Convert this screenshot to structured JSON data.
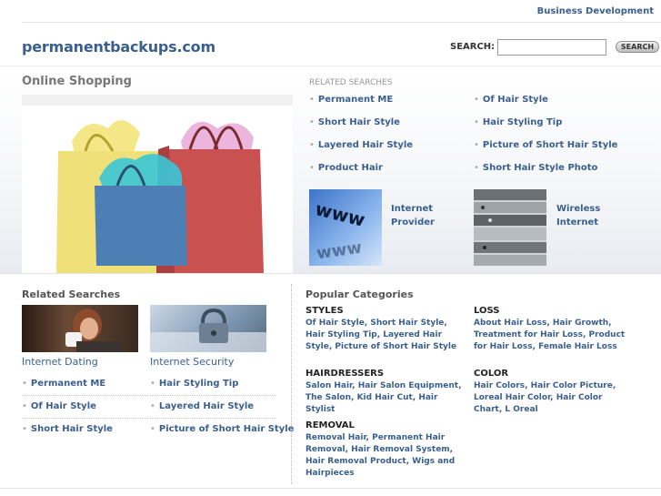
{
  "top": {
    "business_link": "Business Development"
  },
  "header": {
    "logo": "permanentbackups.com",
    "search_label": "SEARCH:",
    "search_value": "",
    "search_button": "SEARCH"
  },
  "hero": {
    "title": "Online Shopping"
  },
  "related": {
    "label": "RELATED SEARCHES",
    "col1": [
      "Permanent ME",
      "Short Hair Style",
      "Layered Hair Style",
      "Product Hair"
    ],
    "col2": [
      "Of Hair Style",
      "Hair Styling Tip",
      "Picture of Short Hair Style",
      "Short Hair Style Photo"
    ],
    "promos": [
      {
        "line1": "Internet",
        "line2": "Provider"
      },
      {
        "line1": "Wireless",
        "line2": "Internet"
      }
    ]
  },
  "lower": {
    "related_title": "Related Searches",
    "left": {
      "title": "Internet Dating",
      "links": [
        "Permanent ME",
        "Of Hair Style",
        "Short Hair Style"
      ]
    },
    "right": {
      "title": "Internet Security",
      "links": [
        "Hair Styling Tip",
        "Layered Hair Style",
        "Picture of Short Hair Style"
      ]
    },
    "popular_title": "Popular Categories",
    "categories": [
      {
        "head": "STYLES",
        "body": "Of Hair Style, Short Hair Style, Hair Styling Tip, Layered Hair Style, Picture of Short Hair Style"
      },
      {
        "head": "LOSS",
        "body": "About Hair Loss, Hair Growth, Treatment for Hair Loss, Product for Hair Loss, Female Hair Loss"
      },
      {
        "head": "HAIRDRESSERS",
        "body": "Salon Hair, Hair Salon Equipment, The Salon, Kid Hair Cut, Hair Stylist"
      },
      {
        "head": "COLOR",
        "body": "Hair Colors, Hair Color Picture, Loreal Hair Color, Hair Color Chart, L Oreal"
      },
      {
        "head": "REMOVAL",
        "body": "Removal Hair, Permanent Hair Removal, Hair Removal System, Hair Removal Product, Wigs and Hairpieces"
      }
    ]
  }
}
